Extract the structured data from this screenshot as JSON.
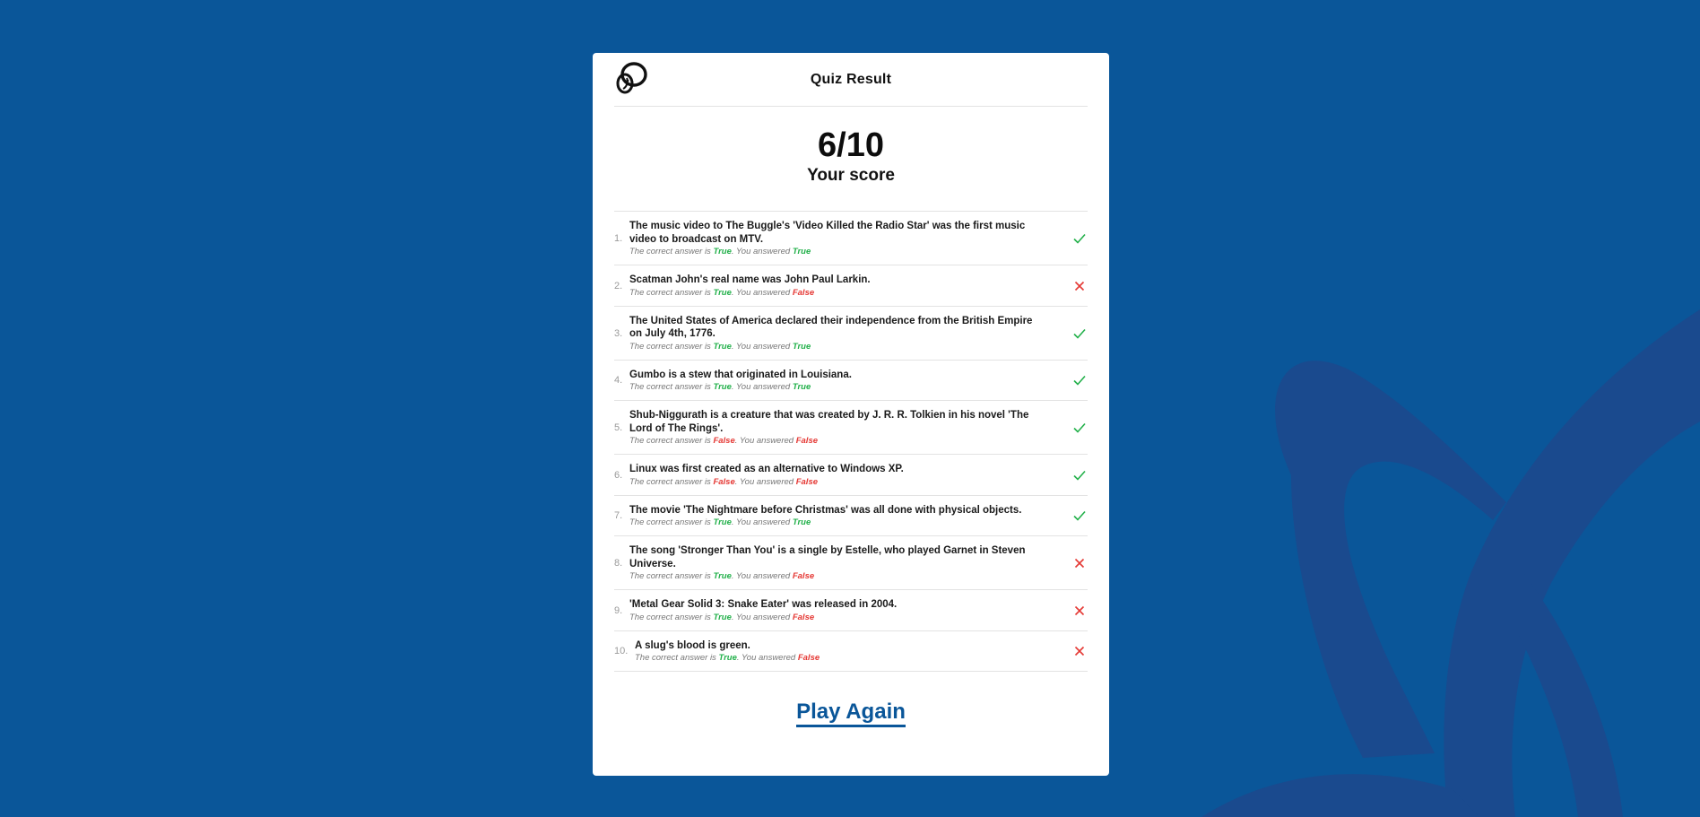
{
  "header": {
    "title": "Quiz Result"
  },
  "score": {
    "value": "6/10",
    "label": "Your score"
  },
  "answer_prefix": "The correct answer is",
  "you_answered": "You answered",
  "questions": [
    {
      "num": "1.",
      "text": "The music video to The Buggle's 'Video Killed the Radio Star' was the first music video to broadcast on MTV.",
      "correct": "True",
      "given": "True",
      "result": "check-icon"
    },
    {
      "num": "2.",
      "text": "Scatman John's real name was John Paul Larkin.",
      "correct": "True",
      "given": "False",
      "result": "cross-icon"
    },
    {
      "num": "3.",
      "text": "The United States of America declared their independence from the British Empire on July 4th, 1776.",
      "correct": "True",
      "given": "True",
      "result": "check-icon"
    },
    {
      "num": "4.",
      "text": "Gumbo is a stew that originated in Louisiana.",
      "correct": "True",
      "given": "True",
      "result": "check-icon"
    },
    {
      "num": "5.",
      "text": "Shub-Niggurath is a creature that was created by J. R. R. Tolkien in his novel 'The Lord of The Rings'.",
      "correct": "False",
      "given": "False",
      "result": "check-icon"
    },
    {
      "num": "6.",
      "text": "Linux was first created as an alternative to Windows XP.",
      "correct": "False",
      "given": "False",
      "result": "check-icon"
    },
    {
      "num": "7.",
      "text": "The movie 'The Nightmare before Christmas' was all done with physical objects.",
      "correct": "True",
      "given": "True",
      "result": "check-icon"
    },
    {
      "num": "8.",
      "text": "The song 'Stronger Than You' is a single by Estelle, who played Garnet in Steven Universe.",
      "correct": "True",
      "given": "False",
      "result": "cross-icon"
    },
    {
      "num": "9.",
      "text": "'Metal Gear Solid 3: Snake Eater' was released in 2004.",
      "correct": "True",
      "given": "False",
      "result": "cross-icon"
    },
    {
      "num": "10.",
      "text": "A slug's blood is green.",
      "correct": "True",
      "given": "False",
      "result": "cross-icon"
    }
  ],
  "actions": {
    "play_again": "Play Again"
  },
  "colors": {
    "background": "#0a5699",
    "true": "#22b04a",
    "false": "#e53935",
    "link": "#0a5699"
  }
}
